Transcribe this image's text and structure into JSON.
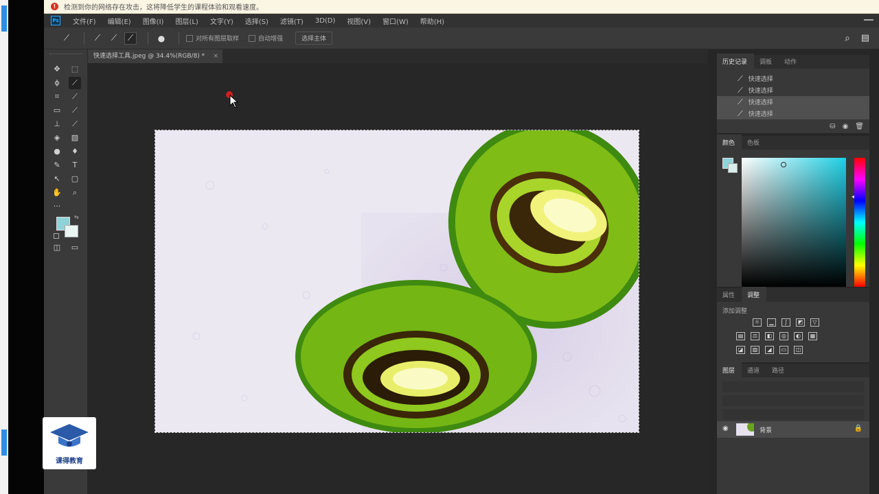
{
  "browser_warning": {
    "text": "检测到你的网络存在攻击，这将降低学生的课程体验和观看速度。"
  },
  "menubar": {
    "app_badge": "Ps",
    "items": [
      "文件(F)",
      "编辑(E)",
      "图像(I)",
      "图层(L)",
      "文字(Y)",
      "选择(S)",
      "滤镜(T)",
      "3D(D)",
      "视图(V)",
      "窗口(W)",
      "帮助(H)"
    ]
  },
  "options_bar": {
    "sample_all_layers": "对所有图层取样",
    "auto_enhance": "自动增强",
    "select_subject": "选择主体"
  },
  "document": {
    "tab_title": "快速选择工具.jpeg @ 34.4%(RGB/8) *",
    "close": "×"
  },
  "panels": {
    "history": {
      "tabs": [
        "历史记录",
        "调板",
        "动作"
      ],
      "items": [
        "快速选择",
        "快速选择",
        "快速选择",
        "快速选择"
      ]
    },
    "color": {
      "tabs": [
        "颜色",
        "色板"
      ],
      "foreground": "#8fd3d9",
      "background": "#e9f5f2"
    },
    "adjustments": {
      "tabs": [
        "属性",
        "调整"
      ],
      "title": "添加调整"
    },
    "layers": {
      "tabs": [
        "图层",
        "通道",
        "路径"
      ],
      "layer_name": "背景"
    }
  },
  "watermark": {
    "text": "课得教育"
  }
}
